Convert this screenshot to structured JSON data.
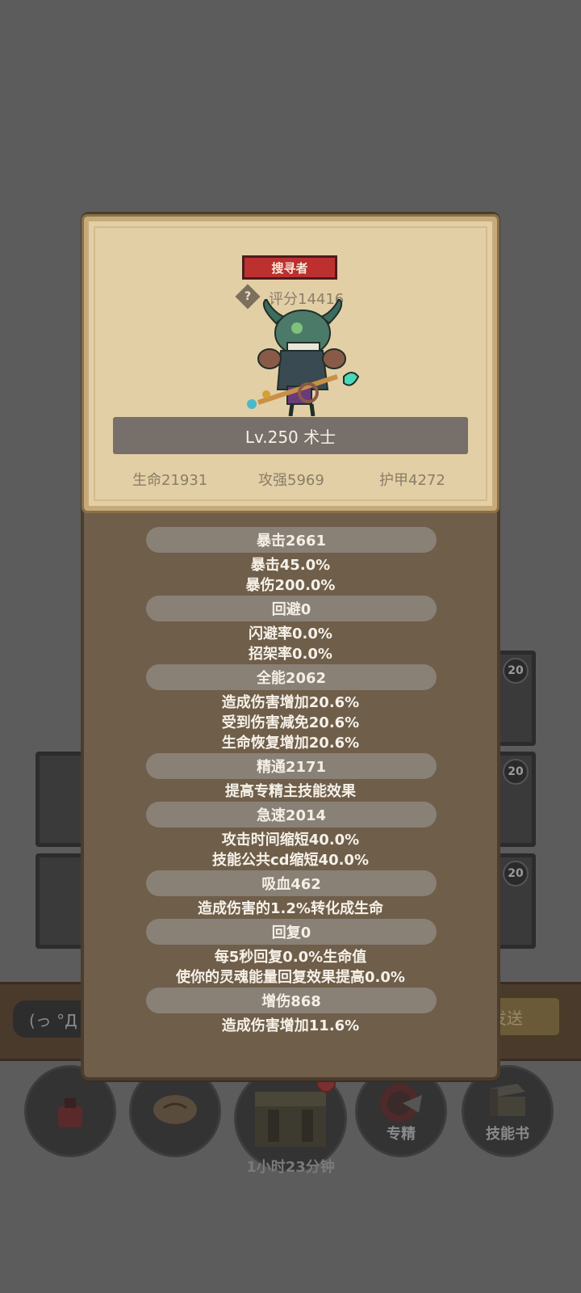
{
  "background": {
    "level_badges": [
      "20",
      "20",
      "20"
    ],
    "chat_placeholder": "(っ °Д °",
    "send_label": "发送",
    "dock": {
      "specialize_label": "专精",
      "skillbook_label": "技能书",
      "chest_timer": "1小时23分钟"
    }
  },
  "dialog": {
    "title_badge": "搜寻者",
    "rating": "评分14416",
    "level_class": "Lv.250 术士",
    "base_stats": {
      "hp": "生命21931",
      "attack": "攻强5969",
      "armor": "护甲4272"
    },
    "sections": [
      {
        "title": "暴击2661",
        "lines": [
          "暴击45.0%",
          "暴伤200.0%"
        ]
      },
      {
        "title": "回避0",
        "lines": [
          "闪避率0.0%",
          "招架率0.0%"
        ]
      },
      {
        "title": "全能2062",
        "lines": [
          "造成伤害增加20.6%",
          "受到伤害减免20.6%",
          "生命恢复增加20.6%"
        ]
      },
      {
        "title": "精通2171",
        "lines": [
          "提高专精主技能效果"
        ]
      },
      {
        "title": "急速2014",
        "lines": [
          "攻击时间缩短40.0%",
          "技能公共cd缩短40.0%"
        ]
      },
      {
        "title": "吸血462",
        "lines": [
          "造成伤害的1.2%转化成生命"
        ]
      },
      {
        "title": "回复0",
        "lines": [
          "每5秒回复0.0%生命值",
          "使你的灵魂能量回复效果提高0.0%"
        ]
      },
      {
        "title": "增伤868",
        "lines": [
          "造成伤害增加11.6%"
        ]
      }
    ]
  }
}
